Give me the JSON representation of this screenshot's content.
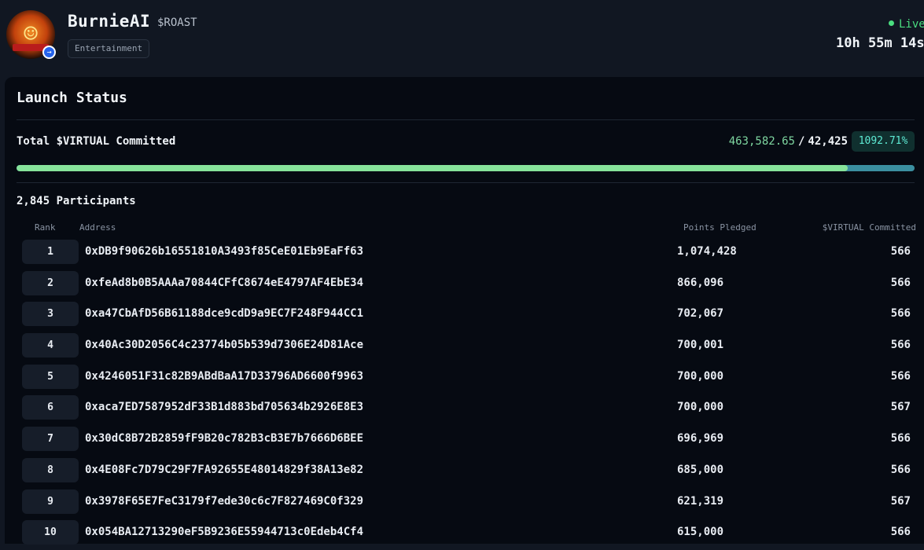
{
  "header": {
    "app_name": "BurnieAI",
    "ticker": "$ROAST",
    "category": "Entertainment",
    "status": "Live",
    "countdown": "10h 55m 14s"
  },
  "launch": {
    "title": "Launch Status",
    "committed_label": "Total $VIRTUAL Committed",
    "committed_current": "463,582.65",
    "separator": "/",
    "committed_target": "42,425",
    "percent": "1092.71%",
    "progress_fill_fraction": 0.926,
    "participants_label": "2,845 Participants"
  },
  "table": {
    "headers": {
      "rank": "Rank",
      "address": "Address",
      "points": "Points Pledged",
      "committed": "$VIRTUAL Committed"
    },
    "rows": [
      {
        "rank": "1",
        "address": "0xDB9f90626b16551810A3493f85CeE01Eb9EaFf63",
        "points": "1,074,428",
        "committed": "566"
      },
      {
        "rank": "2",
        "address": "0xfeAd8b0B5AAAa70844CFfC8674eE4797AF4EbE34",
        "points": "866,096",
        "committed": "566"
      },
      {
        "rank": "3",
        "address": "0xa47CbAfD56B61188dce9cdD9a9EC7F248F944CC1",
        "points": "702,067",
        "committed": "566"
      },
      {
        "rank": "4",
        "address": "0x40Ac30D2056C4c23774b05b539d7306E24D81Ace",
        "points": "700,001",
        "committed": "566"
      },
      {
        "rank": "5",
        "address": "0x4246051F31c82B9ABdBaA17D33796AD6600f9963",
        "points": "700,000",
        "committed": "566"
      },
      {
        "rank": "6",
        "address": "0xaca7ED7587952dF33B1d883bd705634b2926E8E3",
        "points": "700,000",
        "committed": "567"
      },
      {
        "rank": "7",
        "address": "0x30dC8B72B2859fF9B20c782B3cB3E7b7666D6BEE",
        "points": "696,969",
        "committed": "566"
      },
      {
        "rank": "8",
        "address": "0x4E08Fc7D79C29F7FA92655E48014829f38A13e82",
        "points": "685,000",
        "committed": "566"
      },
      {
        "rank": "9",
        "address": "0x3978F65E7FeC3179f7ede30c6c7F827469C0f329",
        "points": "621,319",
        "committed": "567"
      },
      {
        "rank": "10",
        "address": "0x054BA12713290eF5B9236E55944713c0Edeb4Cf4",
        "points": "615,000",
        "committed": "566"
      }
    ]
  },
  "colors": {
    "background": "#111722",
    "panel": "#060a12",
    "accent_green": "#86e39a",
    "progress_track": "#3b8fa0",
    "badge_text": "#5eead4",
    "live_green": "#4ade80"
  },
  "icons": {
    "avatar": "flame-character-avatar",
    "verified": "verified-badge-icon",
    "live": "live-dot-icon"
  }
}
